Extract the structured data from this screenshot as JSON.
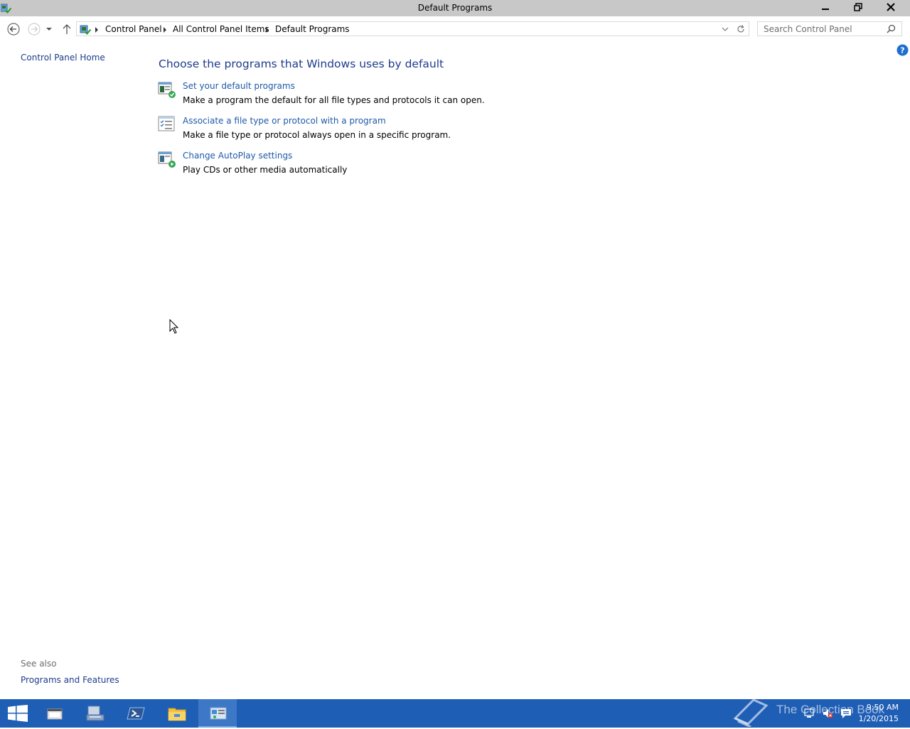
{
  "window": {
    "title": "Default Programs",
    "minimize_icon": "minimize-icon",
    "restore_icon": "restore-icon",
    "close_icon": "close-icon"
  },
  "nav": {
    "breadcrumb": [
      "Control Panel",
      "All Control Panel Items",
      "Default Programs"
    ],
    "search_placeholder": "Search Control Panel"
  },
  "left_pane": {
    "home_link": "Control Panel Home",
    "see_also_label": "See also",
    "see_also_links": [
      "Programs and Features"
    ]
  },
  "main": {
    "heading": "Choose the programs that Windows uses by default",
    "tasks": [
      {
        "link": "Set your default programs",
        "desc": "Make a program the default for all file types and protocols it can open.",
        "icon": "default-programs-icon"
      },
      {
        "link": "Associate a file type or protocol with a program",
        "desc": "Make a file type or protocol always open in a specific program.",
        "icon": "file-association-icon"
      },
      {
        "link": "Change AutoPlay settings",
        "desc": "Play CDs or other media automatically",
        "icon": "autoplay-icon"
      }
    ]
  },
  "taskbar": {
    "apps": [
      "start",
      "server-manager",
      "file-explorer-tools",
      "powershell",
      "file-explorer",
      "control-panel"
    ],
    "watermark": "The Collection Book",
    "time": "9:50 AM",
    "date": "1/20/2015"
  },
  "colors": {
    "titlebar": "#c8c8c8",
    "link": "#1e5aa8",
    "heading": "#1e3c8c",
    "taskbar": "#1f5eb5"
  }
}
